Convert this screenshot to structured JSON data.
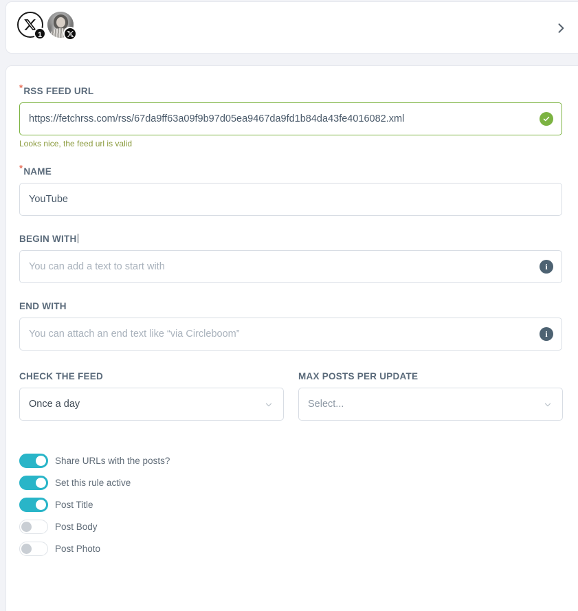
{
  "header": {
    "accounts": [
      {
        "name": "x-platform-account",
        "icon": "x-logo-icon",
        "badge": "1",
        "badge_type": "count"
      },
      {
        "name": "user-profile-account",
        "icon": "user-avatar",
        "badge": "X",
        "badge_type": "x-logo"
      }
    ],
    "next_icon": "chevron-right-icon"
  },
  "form": {
    "rss_feed": {
      "label": "RSS FEED URL",
      "required_marker": "*",
      "value": "https://fetchrss.com/rss/67da9ff63a09f9b97d05ea9467da9fd1b84da43fe4016082.xml",
      "validation_message": "Looks nice, the feed url is valid",
      "valid_icon": "check-circle-icon",
      "valid_color": "#7cb342"
    },
    "name": {
      "label": "NAME",
      "required_marker": "*",
      "value": "YouTube"
    },
    "begin_with": {
      "label": "BEGIN WITH",
      "value": "",
      "placeholder": "You can add a text to start with",
      "info_icon": "info-circle-icon"
    },
    "end_with": {
      "label": "END WITH",
      "value": "",
      "placeholder": "You can attach an end text like “via Circleboom”",
      "info_icon": "info-circle-icon"
    },
    "check_the_feed": {
      "label": "CHECK THE FEED",
      "value": "Once a day",
      "caret_icon": "chevron-down-icon"
    },
    "max_posts_per_update": {
      "label": "MAX POSTS PER UPDATE",
      "value": "Select...",
      "is_placeholder": true,
      "caret_icon": "chevron-down-icon"
    },
    "toggles": [
      {
        "label": "Share URLs with the posts?",
        "on": true
      },
      {
        "label": "Set this rule active",
        "on": true
      },
      {
        "label": "Post Title",
        "on": true
      },
      {
        "label": "Post Body",
        "on": false
      },
      {
        "label": "Post Photo",
        "on": false
      }
    ]
  },
  "colors": {
    "accent_teal": "#29b5c8",
    "valid_green": "#7cb342",
    "hint_green": "#8a9a3c",
    "required_red": "#e8715b",
    "page_bg": "#f2f3f7"
  }
}
